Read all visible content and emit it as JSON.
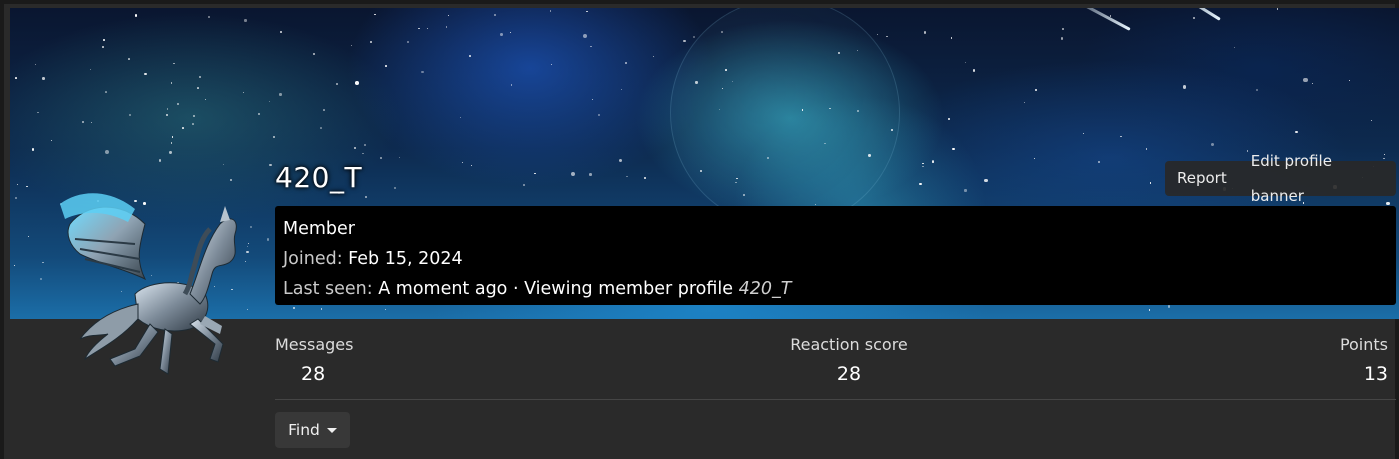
{
  "profile": {
    "username": "420_T",
    "role": "Member",
    "joined_label": "Joined:",
    "joined_value": "Feb 15, 2024",
    "last_seen_label": "Last seen:",
    "last_seen_value": "A moment ago · Viewing member profile",
    "last_seen_target": "420_T"
  },
  "banner_actions": {
    "report_label": "Report",
    "edit_banner_label": "Edit profile banner"
  },
  "avatar": {
    "icon": "winged-horse-avatar-icon"
  },
  "stats": {
    "messages_label": "Messages",
    "messages_value": "28",
    "reaction_label": "Reaction score",
    "reaction_value": "28",
    "points_label": "Points",
    "points_value": "13"
  },
  "find": {
    "label": "Find",
    "icon": "chevron-down-icon"
  },
  "colors": {
    "background": "#2a2a2a",
    "info_box": "#000000",
    "button_bg": "#383838",
    "banner_accent": "#1b6ea8"
  }
}
